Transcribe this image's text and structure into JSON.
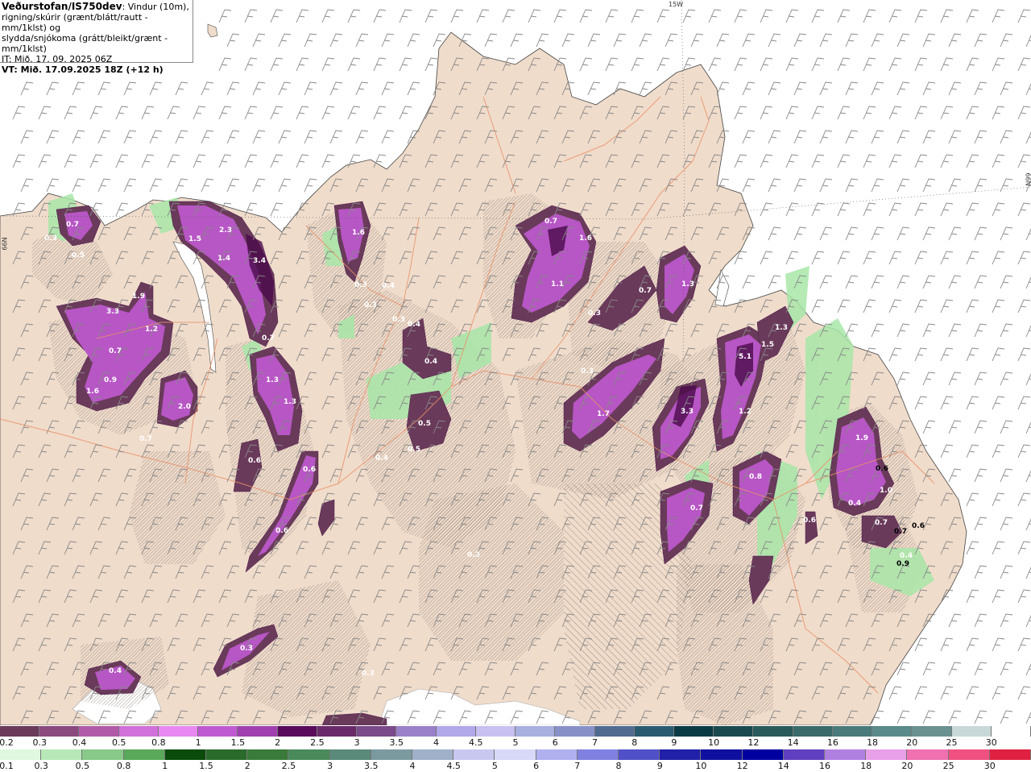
{
  "title": {
    "brand": "Veðurstofan/IS750dev",
    "description_line1": ": Vindur (10m),",
    "description_line2": "rigning/skúrir (grænt/blátt/rautt - mm/1klst) og",
    "description_line3": "slydda/snjókoma (grátt/bleikt/grænt - mm/1klst)",
    "it": "IT: Mið. 17. 09. 2025 06Z",
    "vt": "VT: Mið. 17.09.2025 18Z (+12 h)"
  },
  "grid_labels": {
    "top_meridian": "15W",
    "right_parallel": "66N",
    "left_parallel": "66N"
  },
  "colors": {
    "sea": "#ffffff",
    "land": "#f0dccb",
    "roads": "#e8916a",
    "snow": "#b84fd2",
    "snow_dark": "#6a2a6a",
    "rain": "#a8e6a8",
    "hatch": "#8a7a72"
  },
  "precip_labels": [
    {
      "text": "0.7",
      "dark": false
    },
    {
      "text": "0.5",
      "dark": false
    },
    {
      "text": "0.3",
      "dark": false
    },
    {
      "text": "1.5",
      "dark": false
    },
    {
      "text": "2.3",
      "dark": false
    },
    {
      "text": "1.4",
      "dark": false
    },
    {
      "text": "3.4",
      "dark": false
    },
    {
      "text": "1.6",
      "dark": false
    },
    {
      "text": "0.3",
      "dark": false
    },
    {
      "text": "0.4",
      "dark": false
    },
    {
      "text": "0.3",
      "dark": false
    },
    {
      "text": "1.9",
      "dark": false
    },
    {
      "text": "3.3",
      "dark": false
    },
    {
      "text": "1.2",
      "dark": false
    },
    {
      "text": "0.7",
      "dark": false
    },
    {
      "text": "0.9",
      "dark": false
    },
    {
      "text": "1.6",
      "dark": false
    },
    {
      "text": "2.0",
      "dark": false
    },
    {
      "text": "0.7",
      "dark": false
    },
    {
      "text": "0.7",
      "dark": false
    },
    {
      "text": "1.3",
      "dark": false
    },
    {
      "text": "1.3",
      "dark": false
    },
    {
      "text": "0.6",
      "dark": false
    },
    {
      "text": "0.6",
      "dark": false
    },
    {
      "text": "0.6",
      "dark": false
    },
    {
      "text": "0.3",
      "dark": false
    },
    {
      "text": "0.4",
      "dark": false
    },
    {
      "text": "0.4",
      "dark": false
    },
    {
      "text": "0.5",
      "dark": false
    },
    {
      "text": "0.5",
      "dark": false
    },
    {
      "text": "0.7",
      "dark": false
    },
    {
      "text": "1.6",
      "dark": false
    },
    {
      "text": "1.1",
      "dark": false
    },
    {
      "text": "0.3",
      "dark": false
    },
    {
      "text": "0.7",
      "dark": false
    },
    {
      "text": "1.3",
      "dark": false
    },
    {
      "text": "0.3",
      "dark": false
    },
    {
      "text": "1.7",
      "dark": false
    },
    {
      "text": "3.3",
      "dark": false
    },
    {
      "text": "5.1",
      "dark": false
    },
    {
      "text": "1.5",
      "dark": false
    },
    {
      "text": "1.3",
      "dark": false
    },
    {
      "text": "1.2",
      "dark": false
    },
    {
      "text": "0.8",
      "dark": false
    },
    {
      "text": "0.7",
      "dark": false
    },
    {
      "text": "1.9",
      "dark": false
    },
    {
      "text": "0.6",
      "dark": true
    },
    {
      "text": "1.0",
      "dark": false
    },
    {
      "text": "0.4",
      "dark": false
    },
    {
      "text": "0.7",
      "dark": true
    },
    {
      "text": "0.6",
      "dark": true
    },
    {
      "text": "0.7",
      "dark": false
    },
    {
      "text": "0.4",
      "dark": false
    },
    {
      "text": "0.9",
      "dark": true
    },
    {
      "text": "0.6",
      "dark": false
    },
    {
      "text": "0.3",
      "dark": false
    },
    {
      "text": "0.4",
      "dark": false
    },
    {
      "text": "0.3",
      "dark": false
    },
    {
      "text": "0.4",
      "dark": false
    },
    {
      "text": "0.3",
      "dark": false
    }
  ],
  "legend_snow": {
    "labels": [
      "0.2",
      "0.3",
      "0.4",
      "0.5",
      "0.8",
      "1",
      "1.5",
      "2",
      "2.5",
      "3",
      "3.5",
      "4",
      "4.5",
      "5",
      "6",
      "7",
      "8",
      "9",
      "10",
      "12",
      "14",
      "16",
      "18",
      "20",
      "25",
      "30"
    ],
    "colors": [
      "#6a3a5a",
      "#8a4a7e",
      "#b05aa8",
      "#d070d8",
      "#e888f0",
      "#c05ad0",
      "#a040b0",
      "#5a0a5a",
      "#6a2a6a",
      "#7a4a8a",
      "#9a80c8",
      "#b0a8e8",
      "#c8c0f0",
      "#a8b0e0",
      "#8890c8",
      "#506a90",
      "#2a5a70",
      "#0a3a44",
      "#1a4a50",
      "#2a5a5a",
      "#3a6a6a",
      "#4a7a7a",
      "#5a8a8a",
      "#6a9090",
      "#c8d8d8",
      "#ffffff"
    ]
  },
  "legend_rain": {
    "labels": [
      "0.1",
      "0.3",
      "0.5",
      "0.8",
      "1",
      "1.5",
      "2",
      "2.5",
      "3",
      "3.5",
      "4",
      "4.5",
      "5",
      "6",
      "7",
      "8",
      "9",
      "10",
      "12",
      "14",
      "16",
      "18",
      "20",
      "25",
      "30"
    ],
    "colors": [
      "#e0f8e0",
      "#b8e8b8",
      "#88c888",
      "#5aa85a",
      "#0a4a0a",
      "#2a6a2a",
      "#3a7a3a",
      "#4a8a5a",
      "#5a8a7a",
      "#7a9aa0",
      "#a0b0c8",
      "#c8c8f0",
      "#d8d8f8",
      "#b0b0f0",
      "#8080e0",
      "#5050c8",
      "#2020a8",
      "#1010a0",
      "#0000a0",
      "#6040c0",
      "#b080e0",
      "#e8a0e8",
      "#f070b0",
      "#f05080",
      "#e02040"
    ]
  }
}
